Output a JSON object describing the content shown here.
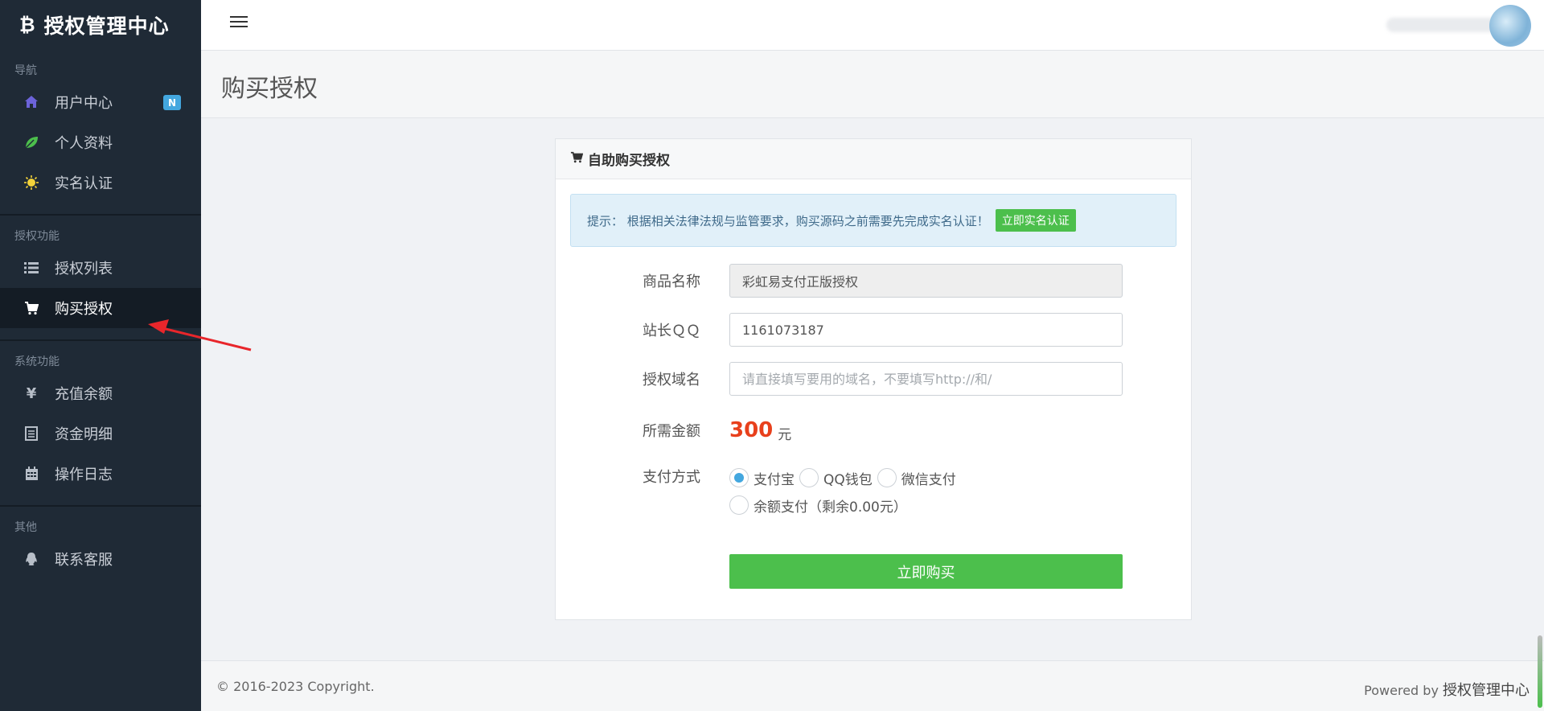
{
  "brand": {
    "name": "授权管理中心",
    "logo_icon": "bitcoin-icon"
  },
  "sidebar": {
    "sections": [
      {
        "title": "导航"
      },
      {
        "title": "授权功能"
      },
      {
        "title": "系统功能"
      },
      {
        "title": "其他"
      }
    ],
    "items": [
      {
        "label": "用户中心",
        "icon": "home-icon",
        "badge": "N"
      },
      {
        "label": "个人资料",
        "icon": "leaf-icon"
      },
      {
        "label": "实名认证",
        "icon": "sun-icon"
      },
      {
        "label": "授权列表",
        "icon": "list-icon"
      },
      {
        "label": "购买授权",
        "icon": "cart-icon",
        "active": true
      },
      {
        "label": "充值余额",
        "icon": "yen-icon"
      },
      {
        "label": "资金明细",
        "icon": "ledger-icon"
      },
      {
        "label": "操作日志",
        "icon": "calendar-icon"
      },
      {
        "label": "联系客服",
        "icon": "qq-icon"
      }
    ]
  },
  "page": {
    "title": "购买授权"
  },
  "card": {
    "title": "自助购买授权",
    "alert_text": "提示：  根据相关法律法规与监管要求，购买源码之前需要先完成实名认证！",
    "alert_button": "立即实名认证"
  },
  "form": {
    "product_label": "商品名称",
    "product_value": "彩虹易支付正版授权",
    "qq_label": "站长ＱＱ",
    "qq_value": "1161073187",
    "domain_label": "授权域名",
    "domain_placeholder": "请直接填写要用的域名，不要填写http://和/",
    "amount_label": "所需金额",
    "amount_value": "300",
    "amount_unit": "元",
    "payment_label": "支付方式",
    "payment_options": [
      {
        "label": "支付宝",
        "checked": true
      },
      {
        "label": "QQ钱包",
        "checked": false
      },
      {
        "label": "微信支付",
        "checked": false
      },
      {
        "label": "余额支付（剩余0.00元）",
        "checked": false
      }
    ],
    "submit_label": "立即购买"
  },
  "footer": {
    "copyright": "© 2016-2023 Copyright.",
    "powered_prefix": "Powered by ",
    "powered_name": "授权管理中心"
  },
  "colors": {
    "sidebar_bg": "#1f2a36",
    "accent_green": "#4cbf4c",
    "price_red": "#e8401c",
    "radio_blue": "#43a7df",
    "arrow_red": "#e8262b"
  }
}
